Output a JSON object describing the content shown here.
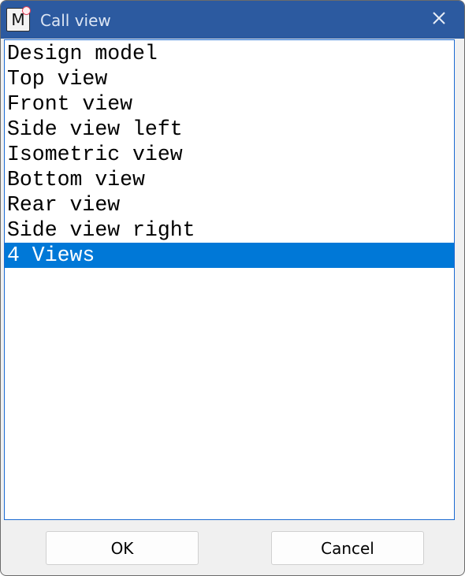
{
  "window": {
    "title": "Call view",
    "icon_glyph": "M",
    "icon": "app-m-icon",
    "titlebar_color": "#2c5aa0"
  },
  "list": {
    "items": [
      {
        "label": "Design model",
        "selected": false
      },
      {
        "label": "Top view",
        "selected": false
      },
      {
        "label": "Front view",
        "selected": false
      },
      {
        "label": "Side view left",
        "selected": false
      },
      {
        "label": "Isometric view",
        "selected": false
      },
      {
        "label": "Bottom view",
        "selected": false
      },
      {
        "label": "Rear view",
        "selected": false
      },
      {
        "label": "Side view right",
        "selected": false
      },
      {
        "label": "4 Views",
        "selected": true
      }
    ],
    "selection_color": "#0078d7"
  },
  "buttons": {
    "ok_label": "OK",
    "cancel_label": "Cancel"
  }
}
